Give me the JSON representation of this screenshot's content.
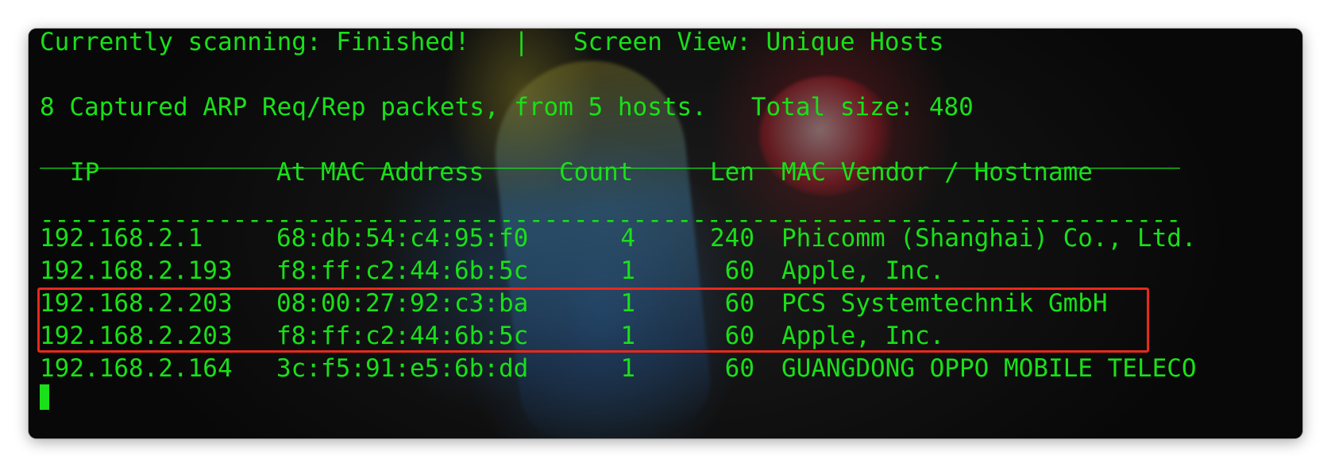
{
  "status": {
    "scanning": "Currently scanning: Finished!   |   Screen View: Unique Hosts",
    "summary": "8 Captured ARP Req/Rep packets, from 5 hosts.   Total size: 480"
  },
  "table": {
    "top_rule": "_____________________________________________________________________________",
    "bottom_rule": "-----------------------------------------------------------------------------",
    "headers": {
      "ip": "IP",
      "mac": "At MAC Address",
      "count": "Count",
      "len": "Len",
      "vendor": "MAC Vendor / Hostname"
    },
    "rows": [
      {
        "ip": "192.168.2.1",
        "mac": "68:db:54:c4:95:f0",
        "count": "4",
        "len": "240",
        "vendor": "Phicomm (Shanghai) Co., Ltd."
      },
      {
        "ip": "192.168.2.193",
        "mac": "f8:ff:c2:44:6b:5c",
        "count": "1",
        "len": "60",
        "vendor": "Apple, Inc."
      },
      {
        "ip": "192.168.2.203",
        "mac": "08:00:27:92:c3:ba",
        "count": "1",
        "len": "60",
        "vendor": "PCS Systemtechnik GmbH"
      },
      {
        "ip": "192.168.2.203",
        "mac": "f8:ff:c2:44:6b:5c",
        "count": "1",
        "len": "60",
        "vendor": "Apple, Inc."
      },
      {
        "ip": "192.168.2.164",
        "mac": "3c:f5:91:e5:6b:dd",
        "count": "1",
        "len": "60",
        "vendor": "GUANGDONG OPPO MOBILE TELECO"
      }
    ]
  },
  "colors": {
    "terminal_text": "#19e019",
    "highlight_border": "#e8291c",
    "background": "#0b0b0b"
  }
}
